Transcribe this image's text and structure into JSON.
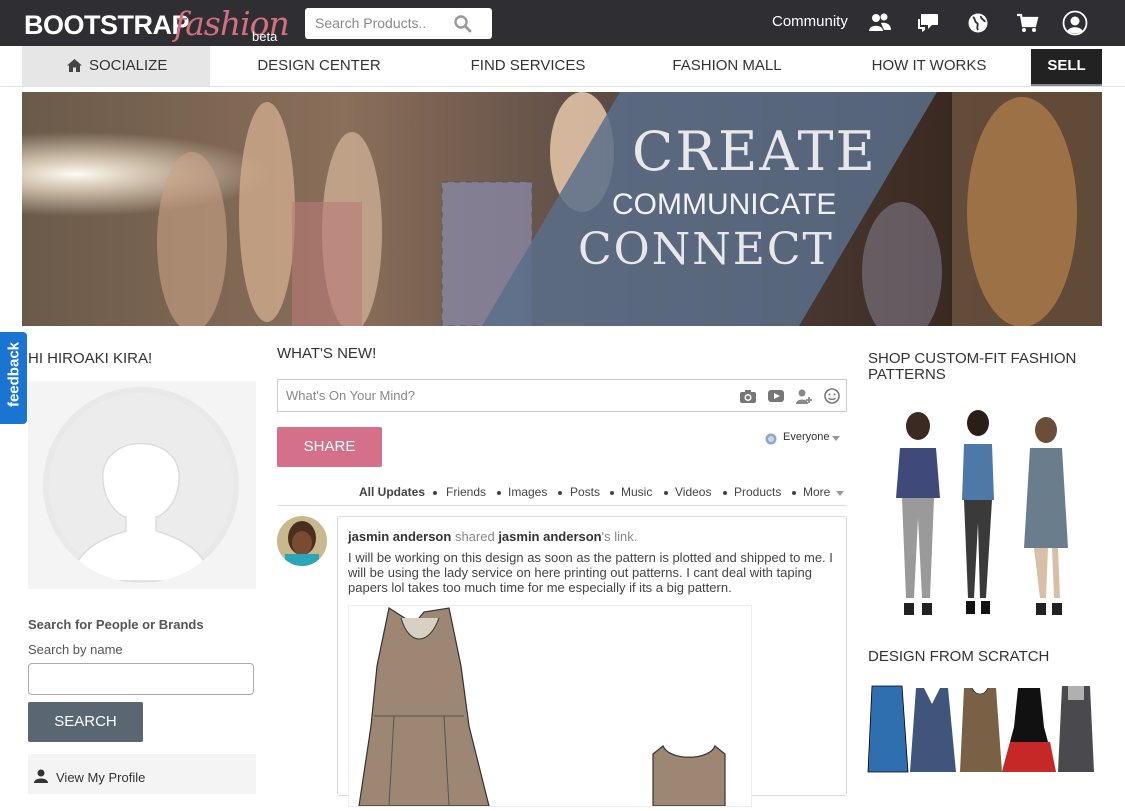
{
  "topbar": {
    "logo_main": "BOOTSTRAP",
    "logo_fashion": "fashion",
    "logo_beta": "beta",
    "search_placeholder": "Search Products..",
    "community": "Community"
  },
  "nav": {
    "items": [
      {
        "label": "SOCIALIZE"
      },
      {
        "label": "DESIGN CENTER"
      },
      {
        "label": "FIND SERVICES"
      },
      {
        "label": "FASHION MALL"
      },
      {
        "label": "HOW IT WORKS"
      },
      {
        "label": "SELL"
      }
    ]
  },
  "banner": {
    "line1": "CREATE",
    "line2": "COMMUNICATE",
    "line3": "CONNECT"
  },
  "feedback": "feedback",
  "left": {
    "greeting": "HI HIROAKI KIRA!",
    "search_title": "Search for People or Brands",
    "search_label": "Search by name",
    "search_button": "SEARCH",
    "view_profile": "View My Profile"
  },
  "feed": {
    "heading": "WHAT'S NEW!",
    "placeholder": "What's On Your Mind?",
    "share_button": "SHARE",
    "audience": "Everyone",
    "filters": [
      "All Updates",
      "Friends",
      "Images",
      "Posts",
      "Music",
      "Videos",
      "Products",
      "More"
    ],
    "post": {
      "author": "jasmin anderson",
      "action": "shared",
      "target": "jasmin anderson",
      "suffix": "'s link.",
      "text": "I will be working on this design as soon as the pattern is plotted and shipped to me. I will be using the lady service on here printing out patterns. I cant deal with taping papers lol takes too much time for me especially if its a big pattern."
    }
  },
  "right": {
    "shop_title": "SHOP CUSTOM-FIT FASHION PATTERNS",
    "design_title": "DESIGN FROM SCRATCH"
  },
  "colors": {
    "topbar": "#2e2e33",
    "accent_pink": "#d4708a",
    "search_button": "#5b6673",
    "feedback": "#1a75d2"
  }
}
